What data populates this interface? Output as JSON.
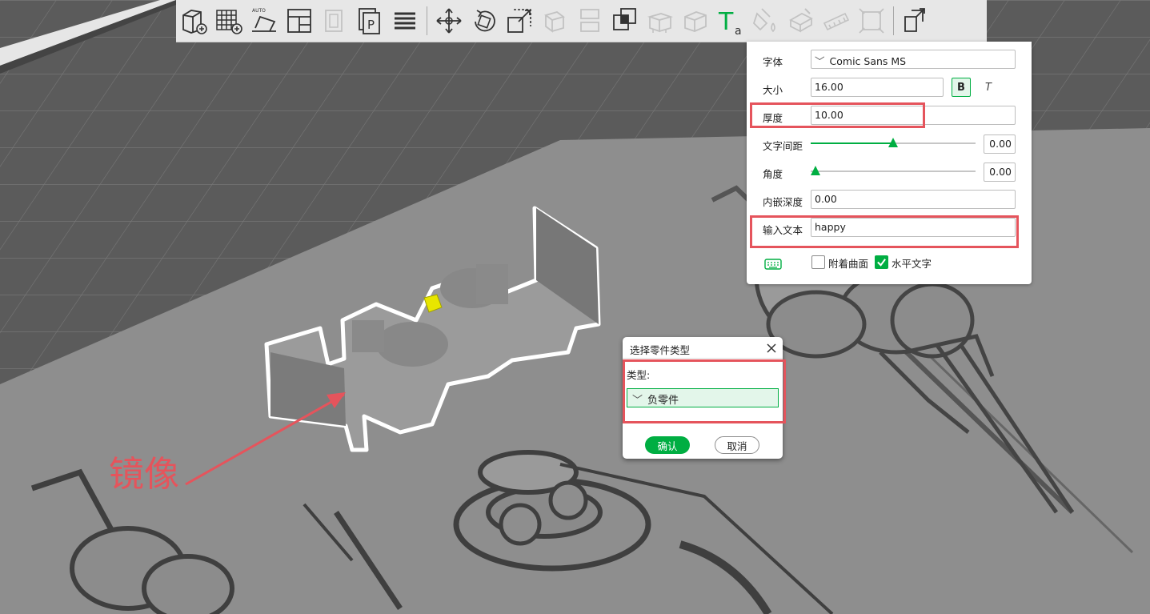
{
  "toolbar": {
    "icons": [
      "add-cube-icon",
      "add-plate-icon",
      "auto-arrange-icon",
      "arrange-layout-icon",
      "orient-icon",
      "plate-p-icon",
      "layers-icon",
      "move-icon",
      "rotate-icon",
      "scale-icon",
      "cut-icon",
      "split-icon",
      "boolean-icon",
      "support-icon",
      "text-icon",
      "paint-icon",
      "seam-icon",
      "measure-icon",
      "assembly-icon",
      "explode-icon"
    ],
    "text_tool_letter": "T",
    "text_tool_sub": "a",
    "auto_label": "AUTO",
    "plate_letter": "P"
  },
  "text_panel": {
    "font_label": "字体",
    "font_value": "Comic Sans MS",
    "size_label": "大小",
    "size_value": "16.00",
    "bold_label": "B",
    "italic_label": "T",
    "thickness_label": "厚度",
    "thickness_value": "10.00",
    "spacing_label": "文字间距",
    "spacing_value": "0.00",
    "spacing_level": 0.5,
    "angle_label": "角度",
    "angle_value": "0.00",
    "angle_level": 0.0,
    "embed_depth_label": "内嵌深度",
    "embed_depth_value": "0.00",
    "input_text_label": "输入文本",
    "input_text_value": "happy",
    "surface_label": "附着曲面",
    "surface_checked": false,
    "horizontal_label": "水平文字",
    "horizontal_checked": true
  },
  "part_type_dialog": {
    "title": "选择零件类型",
    "type_label": "类型:",
    "selected_type": "负零件",
    "confirm_label": "确认",
    "cancel_label": "取消"
  },
  "annotation": {
    "text": "镜像"
  },
  "colors": {
    "accent": "#00ae42",
    "highlight": "#e5545c",
    "object_handle": "#e8e600",
    "plate_bg": "#5d5d5d",
    "plate_surface": "#8e8e8e"
  }
}
